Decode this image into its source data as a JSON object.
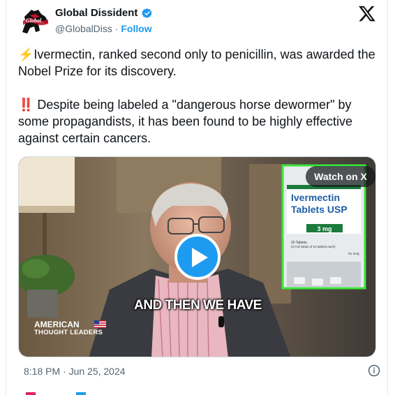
{
  "author": {
    "name": "Global Dissident",
    "handle": "@GlobalDiss",
    "separator": "·",
    "follow_label": "Follow",
    "verified": true,
    "verified_color": "#1d9bf0"
  },
  "tweet": {
    "paragraph_1": "⚡Ivermectin, ranked second only to penicillin, was awarded the Nobel Prize for its discovery.",
    "paragraph_2": "‼️ Despite being labeled a \"dangerous horse dewormer\" by some propagandists, it has been found to be highly effective against certain cancers."
  },
  "media": {
    "watch_label": "Watch on X",
    "caption": "AND THEN WE HAVE",
    "watermark_line1": "AMERICAN",
    "watermark_line2": "THOUGHT LEADERS",
    "pill_box": {
      "line1": "Ivermectin",
      "line2": "Tablets USP",
      "strength": "3 mg",
      "count": "20 Tablets",
      "strips": "(2 Foil Strips of 10 tablets each)",
      "rx": "Rx Only"
    },
    "highlight_color": "#39e639"
  },
  "footer": {
    "timestamp": "8:18 PM · Jun 25, 2024"
  },
  "icons": {
    "verified": "verified-badge-icon",
    "x_logo": "x-logo-icon",
    "play": "play-icon",
    "info": "info-icon"
  },
  "colors": {
    "accent": "#1d9bf0",
    "secondary_text": "#536471",
    "text": "#0f1419"
  }
}
